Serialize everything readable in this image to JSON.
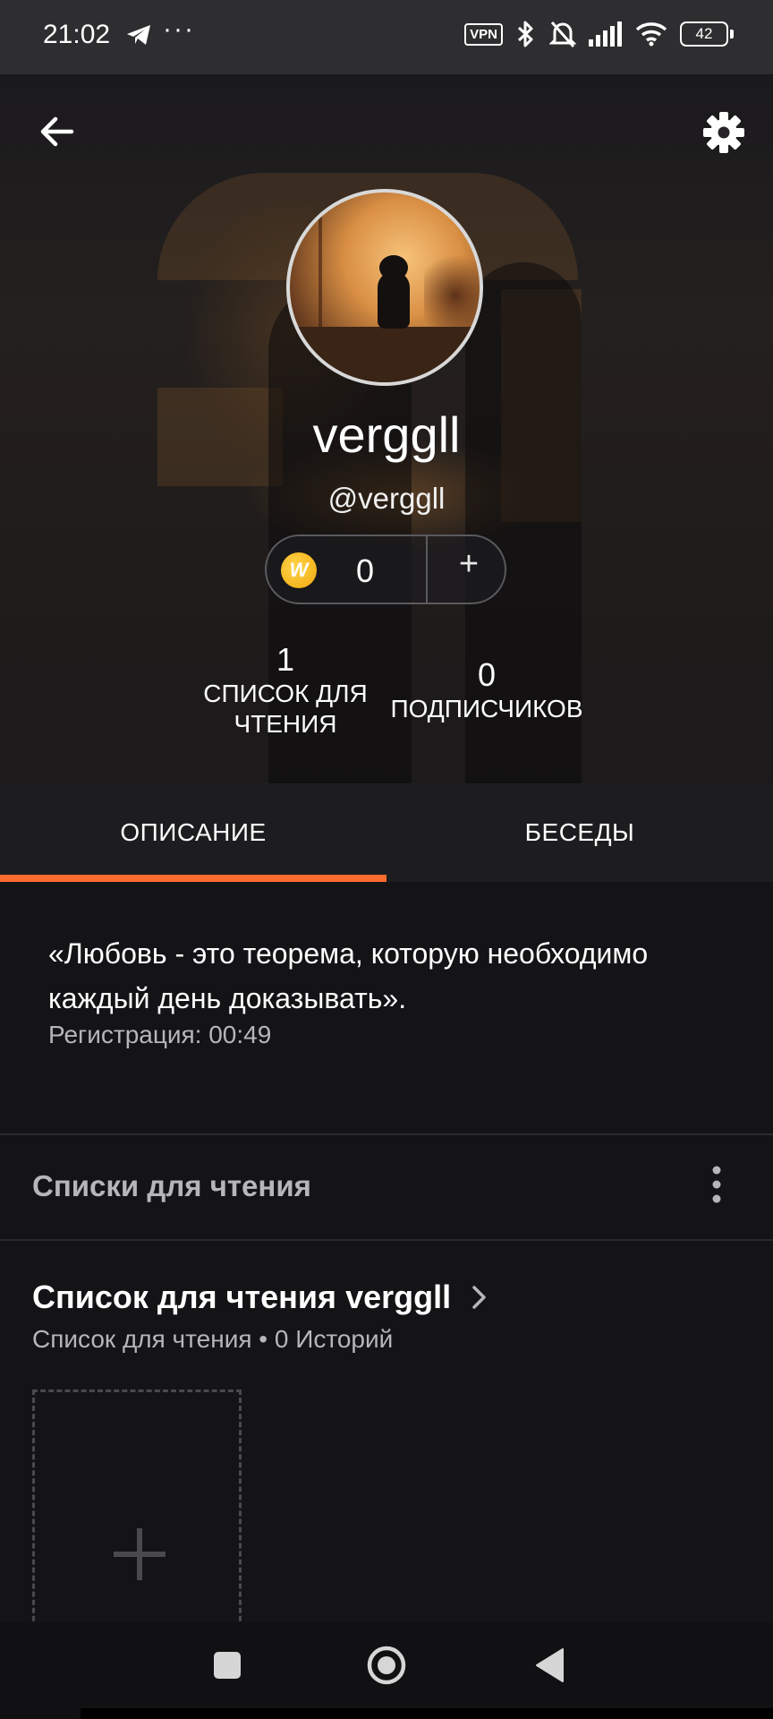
{
  "status_bar": {
    "time": "21:02",
    "dots": "···",
    "vpn": "VPN",
    "battery": "42"
  },
  "profile": {
    "display_name": "verggll",
    "handle": "@verggll",
    "coins": "0",
    "coins_plus": "+",
    "coin_letter": "W"
  },
  "stats": [
    {
      "value": "1",
      "label": "СПИСОК ДЛЯ ЧТЕНИЯ"
    },
    {
      "value": "0",
      "label": "ПОДПИСЧИКОВ"
    }
  ],
  "tabs": [
    {
      "label": "ОПИСАНИЕ",
      "active": true
    },
    {
      "label": "БЕСЕДЫ",
      "active": false
    }
  ],
  "about": {
    "description": "«Любовь - это теорема, которую необходимо каждый день доказывать».",
    "registered": "Регистрация: 00:49"
  },
  "reading_lists": {
    "section_title": "Списки для чтения",
    "list_title": "Список для чтения verggll",
    "list_subtitle": "Список для чтения • 0 Историй"
  },
  "colors": {
    "accent": "#ff6a2e",
    "background": "#141316",
    "coin": "#f0a90c"
  },
  "icons": [
    "back-arrow-icon",
    "settings-gear-icon",
    "coin-icon",
    "more-vertical-icon",
    "chevron-right-icon",
    "add-icon",
    "telegram-icon",
    "bluetooth-icon",
    "bell-off-icon",
    "signal-icon",
    "wifi-icon",
    "battery-icon"
  ]
}
